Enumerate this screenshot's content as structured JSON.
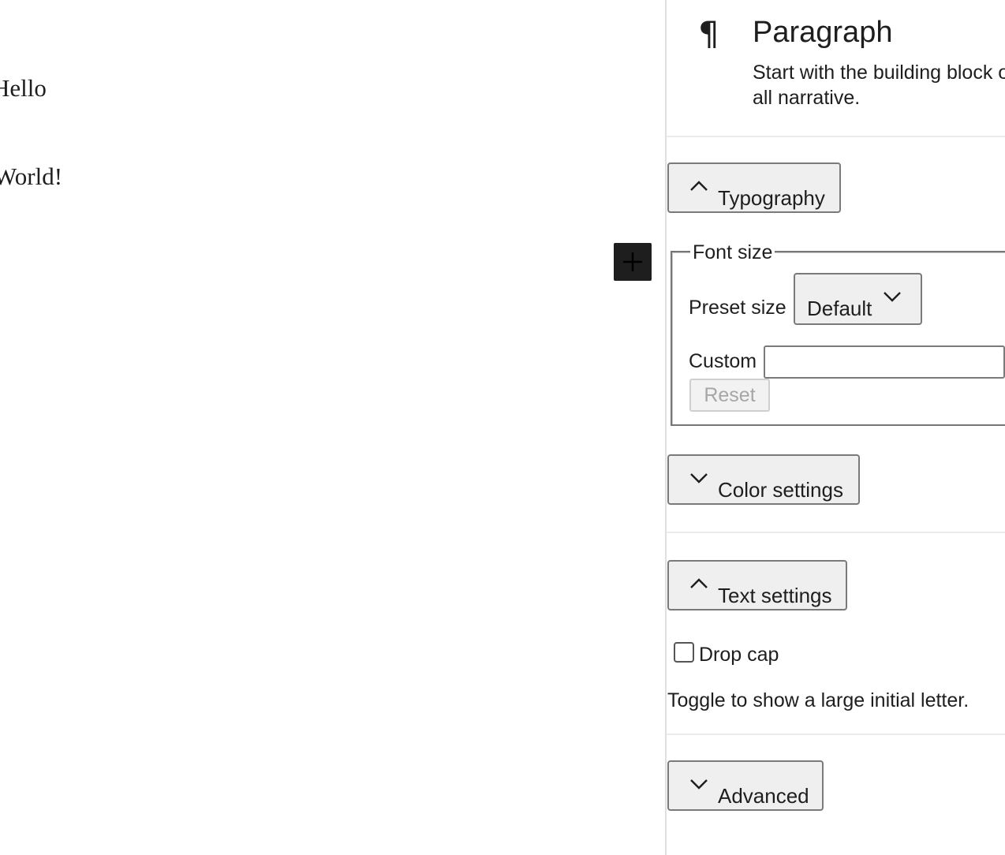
{
  "editor": {
    "paragraphs": [
      "Hello",
      "World!"
    ],
    "inserter_icon": "plus-icon"
  },
  "sidebar": {
    "block": {
      "icon": "¶",
      "title": "Paragraph",
      "description": "Start with the building block of all narrative."
    },
    "typography": {
      "toggle_label": "Typography",
      "expanded": true,
      "font_size_legend": "Font size",
      "preset_label": "Preset size",
      "preset_value": "Default",
      "custom_label": "Custom",
      "custom_value": "",
      "reset_label": "Reset"
    },
    "color_settings": {
      "toggle_label": "Color settings",
      "expanded": false
    },
    "text_settings": {
      "toggle_label": "Text settings",
      "expanded": true,
      "drop_cap_label": "Drop cap",
      "drop_cap_checked": false,
      "drop_cap_help": "Toggle to show a large initial letter."
    },
    "advanced": {
      "toggle_label": "Advanced",
      "expanded": false
    }
  }
}
